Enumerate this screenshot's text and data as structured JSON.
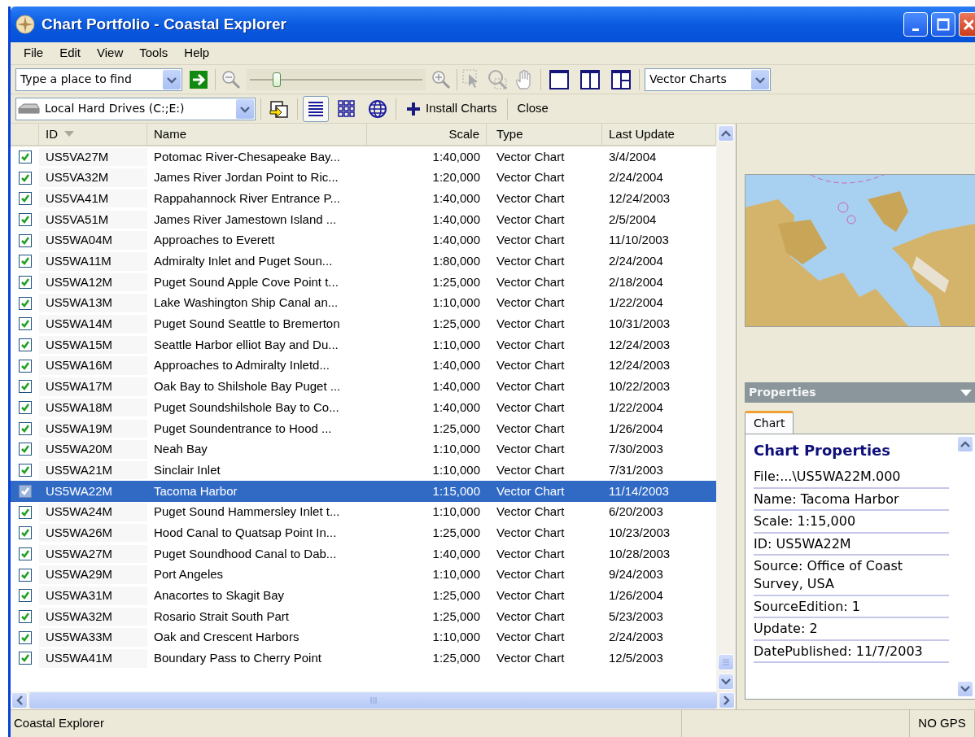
{
  "window": {
    "title": "Chart Portfolio - Coastal Explorer"
  },
  "menu": [
    "File",
    "Edit",
    "View",
    "Tools",
    "Help"
  ],
  "toolbar": {
    "search": {
      "placeholder": "Type a place to find"
    },
    "zoom": {
      "level": 0.17
    },
    "chart_type": "Vector Charts"
  },
  "toolbar2": {
    "source": "Local Hard Drives (C:;E:)",
    "views": [
      {
        "kind": "list",
        "selected": true
      },
      {
        "kind": "grid",
        "selected": false
      },
      {
        "kind": "globe",
        "selected": false
      }
    ],
    "install": "Install Charts",
    "close": "Close"
  },
  "table": {
    "columns": [
      "ID",
      "Name",
      "Scale",
      "Type",
      "Last Update"
    ],
    "rows": [
      {
        "checked": true,
        "selected": false,
        "cells": [
          "US5VA27M",
          "Potomac River-Chesapeake Bay...",
          "1:40,000",
          "Vector Chart",
          "3/4/2004"
        ]
      },
      {
        "checked": true,
        "selected": false,
        "cells": [
          "US5VA32M",
          "James River Jordan Point to Ric...",
          "1:20,000",
          "Vector Chart",
          "2/24/2004"
        ]
      },
      {
        "checked": true,
        "selected": false,
        "cells": [
          "US5VA41M",
          "Rappahannock River Entrance P...",
          "1:40,000",
          "Vector Chart",
          "12/24/2003"
        ]
      },
      {
        "checked": true,
        "selected": false,
        "cells": [
          "US5VA51M",
          "James River Jamestown Island ...",
          "1:40,000",
          "Vector Chart",
          "2/5/2004"
        ]
      },
      {
        "checked": true,
        "selected": false,
        "cells": [
          "US5WA04M",
          "Approaches to Everett",
          "1:40,000",
          "Vector Chart",
          "11/10/2003"
        ]
      },
      {
        "checked": true,
        "selected": false,
        "cells": [
          "US5WA11M",
          "Admiralty Inlet and Puget Soun...",
          "1:80,000",
          "Vector Chart",
          "2/24/2004"
        ]
      },
      {
        "checked": true,
        "selected": false,
        "cells": [
          "US5WA12M",
          "Puget Sound Apple Cove Point t...",
          "1:25,000",
          "Vector Chart",
          "2/18/2004"
        ]
      },
      {
        "checked": true,
        "selected": false,
        "cells": [
          "US5WA13M",
          "Lake Washington Ship Canal an...",
          "1:10,000",
          "Vector Chart",
          "1/22/2004"
        ]
      },
      {
        "checked": true,
        "selected": false,
        "cells": [
          "US5WA14M",
          "Puget Sound Seattle to Bremerton",
          "1:25,000",
          "Vector Chart",
          "10/31/2003"
        ]
      },
      {
        "checked": true,
        "selected": false,
        "cells": [
          "US5WA15M",
          "Seattle Harbor elliot Bay and Du...",
          "1:10,000",
          "Vector Chart",
          "12/24/2003"
        ]
      },
      {
        "checked": true,
        "selected": false,
        "cells": [
          "US5WA16M",
          "Approaches to Admiralty Inletd...",
          "1:40,000",
          "Vector Chart",
          "12/24/2003"
        ]
      },
      {
        "checked": true,
        "selected": false,
        "cells": [
          "US5WA17M",
          "Oak Bay to Shilshole Bay Puget ...",
          "1:40,000",
          "Vector Chart",
          "10/22/2003"
        ]
      },
      {
        "checked": true,
        "selected": false,
        "cells": [
          "US5WA18M",
          "Puget Soundshilshole Bay to Co...",
          "1:40,000",
          "Vector Chart",
          "1/22/2004"
        ]
      },
      {
        "checked": true,
        "selected": false,
        "cells": [
          "US5WA19M",
          "Puget Soundentrance to Hood ...",
          "1:25,000",
          "Vector Chart",
          "1/26/2004"
        ]
      },
      {
        "checked": true,
        "selected": false,
        "cells": [
          "US5WA20M",
          "Neah Bay",
          "1:10,000",
          "Vector Chart",
          "7/30/2003"
        ]
      },
      {
        "checked": true,
        "selected": false,
        "cells": [
          "US5WA21M",
          "Sinclair Inlet",
          "1:10,000",
          "Vector Chart",
          "7/31/2003"
        ]
      },
      {
        "checked": true,
        "selected": true,
        "cells": [
          "US5WA22M",
          "Tacoma Harbor",
          "1:15,000",
          "Vector Chart",
          "11/14/2003"
        ]
      },
      {
        "checked": true,
        "selected": false,
        "cells": [
          "US5WA24M",
          "Puget Sound Hammersley Inlet t...",
          "1:10,000",
          "Vector Chart",
          "6/20/2003"
        ]
      },
      {
        "checked": true,
        "selected": false,
        "cells": [
          "US5WA26M",
          "Hood Canal to Quatsap Point In...",
          "1:25,000",
          "Vector Chart",
          "10/23/2003"
        ]
      },
      {
        "checked": true,
        "selected": false,
        "cells": [
          "US5WA27M",
          "Puget Soundhood Canal to Dab...",
          "1:40,000",
          "Vector Chart",
          "10/28/2003"
        ]
      },
      {
        "checked": true,
        "selected": false,
        "cells": [
          "US5WA29M",
          "Port Angeles",
          "1:10,000",
          "Vector Chart",
          "9/24/2003"
        ]
      },
      {
        "checked": true,
        "selected": false,
        "cells": [
          "US5WA31M",
          "Anacortes to Skagit Bay",
          "1:25,000",
          "Vector Chart",
          "1/26/2004"
        ]
      },
      {
        "checked": true,
        "selected": false,
        "cells": [
          "US5WA32M",
          "Rosario Strait South Part",
          "1:25,000",
          "Vector Chart",
          "5/23/2003"
        ]
      },
      {
        "checked": true,
        "selected": false,
        "cells": [
          "US5WA33M",
          "Oak and Crescent Harbors",
          "1:10,000",
          "Vector Chart",
          "2/24/2003"
        ]
      },
      {
        "checked": true,
        "selected": false,
        "cells": [
          "US5WA41M",
          "Boundary Pass to Cherry Point",
          "1:25,000",
          "Vector Chart",
          "12/5/2003"
        ]
      }
    ]
  },
  "properties": {
    "title": "Properties",
    "tabs": [
      {
        "label": "Chart",
        "selected": true
      }
    ],
    "heading": "Chart Properties",
    "lines": [
      "File:...\\US5WA22M.000",
      "Name: Tacoma Harbor",
      "Scale: 1:15,000",
      "ID: US5WA22M",
      "Source: Office of Coast Survey, USA",
      "SourceEdition: 1",
      "Update: 2",
      "DatePublished: 11/7/2003"
    ]
  },
  "status_bar": [
    "Coastal Explorer",
    "NO GPS"
  ]
}
